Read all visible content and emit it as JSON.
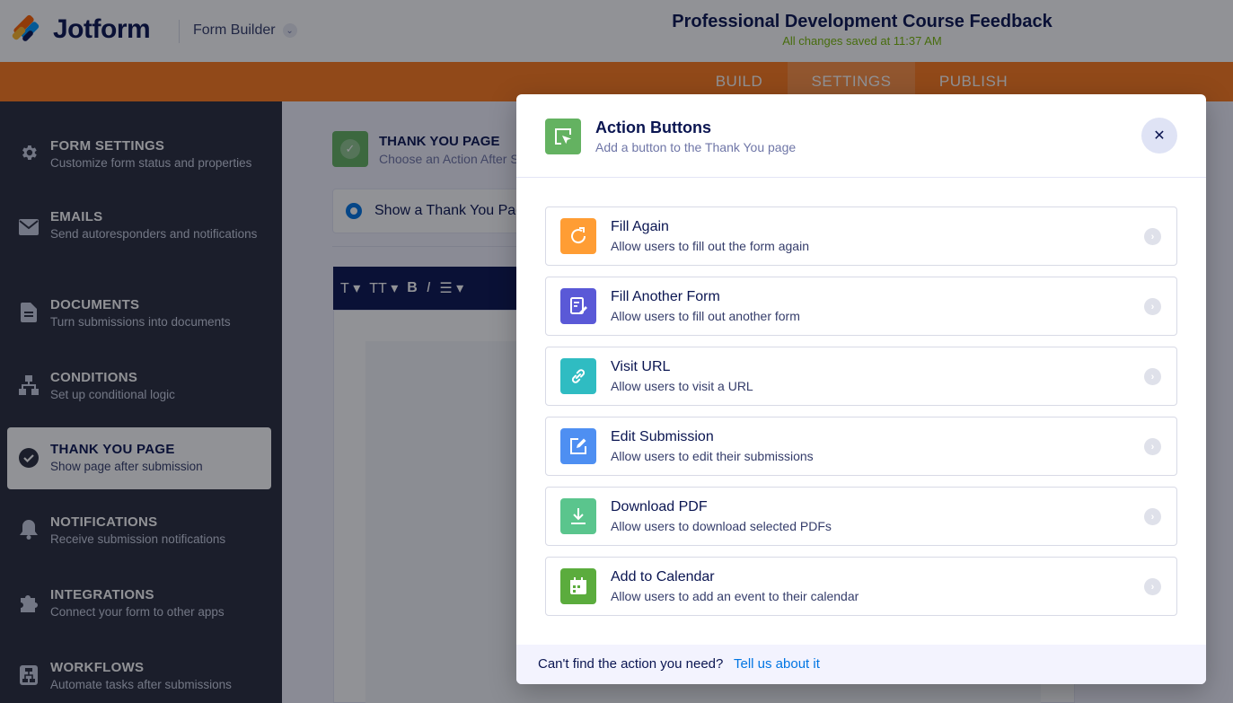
{
  "header": {
    "logo_text": "Jotform",
    "builder_label": "Form Builder",
    "form_title": "Professional Development Course Feedback",
    "save_status": "All changes saved at 11:37 AM"
  },
  "nav": {
    "tabs": [
      {
        "label": "BUILD"
      },
      {
        "label": "SETTINGS"
      },
      {
        "label": "PUBLISH"
      }
    ],
    "active": "SETTINGS"
  },
  "sidebar": {
    "items": [
      {
        "title": "FORM SETTINGS",
        "desc": "Customize form status and properties",
        "icon": "gear-icon"
      },
      {
        "title": "EMAILS",
        "desc": "Send autoresponders and notifications",
        "icon": "envelope-icon"
      },
      {
        "title": "DOCUMENTS",
        "desc": "Turn submissions into documents",
        "icon": "document-icon"
      },
      {
        "title": "CONDITIONS",
        "desc": "Set up conditional logic",
        "icon": "hierarchy-icon"
      },
      {
        "title": "THANK YOU PAGE",
        "desc": "Show page after submission",
        "icon": "check-circle-icon"
      },
      {
        "title": "NOTIFICATIONS",
        "desc": "Receive submission notifications",
        "icon": "bell-icon"
      },
      {
        "title": "INTEGRATIONS",
        "desc": "Connect your form to other apps",
        "icon": "puzzle-icon"
      },
      {
        "title": "WORKFLOWS",
        "desc": "Automate tasks after submissions",
        "icon": "workflow-icon"
      }
    ],
    "active_index": 4
  },
  "main": {
    "section_title": "THANK YOU PAGE",
    "section_sub": "Choose an Action After S",
    "radio_label": "Show a Thank You Pag",
    "toolbar": {
      "text": "T",
      "size": "TT",
      "bold": "B",
      "italic": "I"
    }
  },
  "modal": {
    "title": "Action Buttons",
    "subtitle": "Add a button to the Thank You page",
    "close_symbol": "✕",
    "actions": [
      {
        "title": "Fill Again",
        "desc": "Allow users to fill out the form again",
        "icon": "refresh-icon",
        "color": "#ff9d34"
      },
      {
        "title": "Fill Another Form",
        "desc": "Allow users to fill out another form",
        "icon": "form-edit-icon",
        "color": "#5a59d7"
      },
      {
        "title": "Visit URL",
        "desc": "Allow users to visit a URL",
        "icon": "link-icon",
        "color": "#2fbcc2"
      },
      {
        "title": "Edit Submission",
        "desc": "Allow users to edit their submissions",
        "icon": "edit-icon",
        "color": "#4e8ff2"
      },
      {
        "title": "Download PDF",
        "desc": "Allow users to download selected PDFs",
        "icon": "download-icon",
        "color": "#5ac58d"
      },
      {
        "title": "Add to Calendar",
        "desc": "Allow users to add an event to their calendar",
        "icon": "calendar-icon",
        "color": "#5bac3d"
      }
    ],
    "footer_question": "Can't find the action you need?",
    "footer_link": "Tell us about it"
  },
  "colors": {
    "nav_orange": "#ff7b1c",
    "sidebar_bg": "#292d3c",
    "brand_navy": "#0a1551",
    "link_blue": "#0075e3",
    "success_green": "#78bb07"
  }
}
